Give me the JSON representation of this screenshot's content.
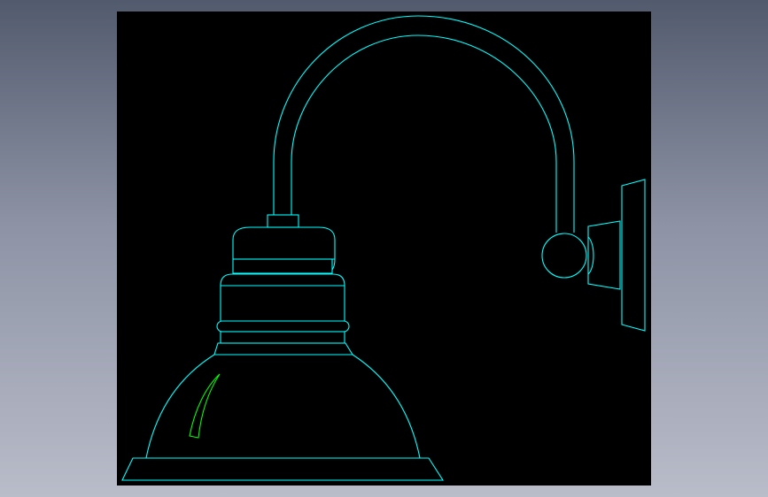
{
  "canvas": {
    "background": "#000000",
    "line_color": "#00ffff",
    "accent_color": "#00ff00"
  },
  "elements": {
    "arm": "gooseneck-arm",
    "bracket": "wall-bracket",
    "shade": "lamp-shade"
  }
}
